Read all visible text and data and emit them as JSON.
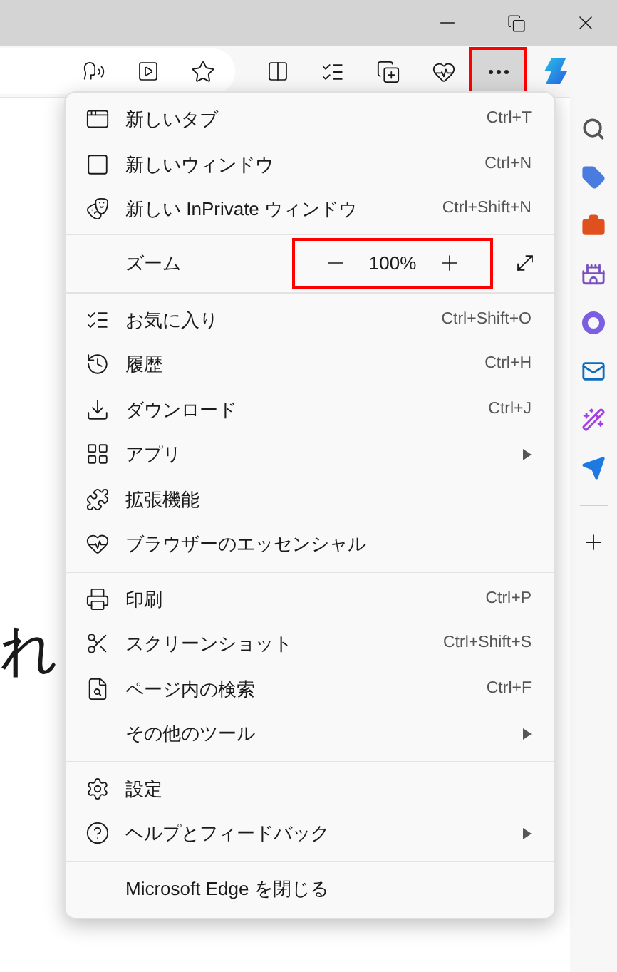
{
  "toolbar": {
    "more_button": {
      "selected": true
    }
  },
  "page": {
    "heading": "れ"
  },
  "menu": {
    "sections": [
      {
        "items": [
          {
            "kind": "item",
            "label": "新しいタブ",
            "shortcut": "Ctrl+T",
            "submenu": false
          },
          {
            "kind": "item",
            "label": "新しいウィンドウ",
            "shortcut": "Ctrl+N",
            "submenu": false
          },
          {
            "kind": "item",
            "label": "新しい InPrivate ウィンドウ",
            "shortcut": "Ctrl+Shift+N",
            "submenu": false
          }
        ]
      },
      {
        "items": [
          {
            "kind": "zoom",
            "label": "ズーム",
            "value": "100%",
            "highlighted": true
          }
        ]
      },
      {
        "items": [
          {
            "kind": "item",
            "label": "お気に入り",
            "shortcut": "Ctrl+Shift+O",
            "submenu": false
          },
          {
            "kind": "item",
            "label": "履歴",
            "shortcut": "Ctrl+H",
            "submenu": false
          },
          {
            "kind": "item",
            "label": "ダウンロード",
            "shortcut": "Ctrl+J",
            "submenu": false
          },
          {
            "kind": "item",
            "label": "アプリ",
            "submenu": true
          },
          {
            "kind": "item",
            "label": "拡張機能",
            "submenu": false
          },
          {
            "kind": "item",
            "label": "ブラウザーのエッセンシャル",
            "submenu": false
          }
        ]
      },
      {
        "items": [
          {
            "kind": "item",
            "label": "印刷",
            "shortcut": "Ctrl+P",
            "submenu": false
          },
          {
            "kind": "item",
            "label": "スクリーンショット",
            "shortcut": "Ctrl+Shift+S",
            "submenu": false
          },
          {
            "kind": "item",
            "label": "ページ内の検索",
            "shortcut": "Ctrl+F",
            "submenu": false
          },
          {
            "kind": "item",
            "label": "その他のツール",
            "submenu": true
          }
        ]
      },
      {
        "items": [
          {
            "kind": "item",
            "label": "設定",
            "submenu": false
          },
          {
            "kind": "item",
            "label": "ヘルプとフィードバック",
            "submenu": true
          }
        ]
      },
      {
        "items": [
          {
            "kind": "item",
            "label": "Microsoft Edge を閉じる",
            "submenu": false
          }
        ]
      }
    ]
  }
}
